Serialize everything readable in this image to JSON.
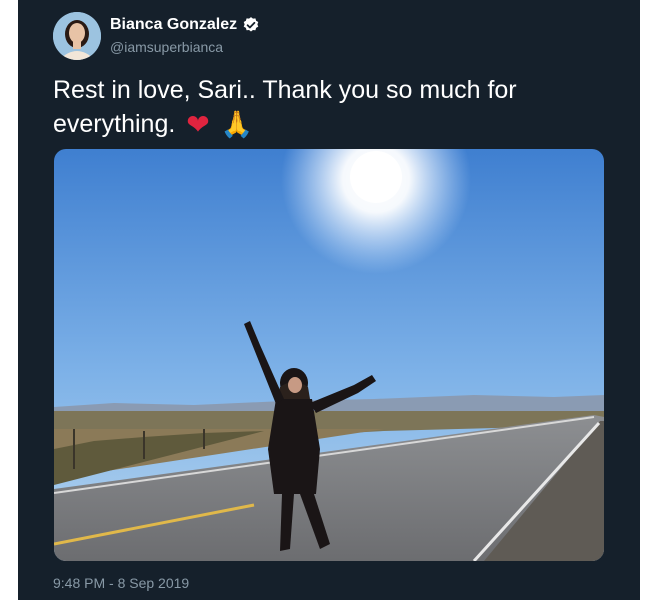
{
  "tweet": {
    "author": {
      "display_name": "Bianca Gonzalez",
      "handle": "@iamsuperbianca",
      "verified_icon": "verified-badge-icon"
    },
    "text": "Rest in love, Sari.. Thank you so much for everything.",
    "emojis": {
      "heart": "❤",
      "pray": "🙏"
    },
    "timestamp": "9:48 PM - 8 Sep 2019"
  },
  "colors": {
    "background": "#15202b",
    "text_primary": "#ffffff",
    "text_secondary": "#8899a6",
    "heart": "#e0243f"
  }
}
